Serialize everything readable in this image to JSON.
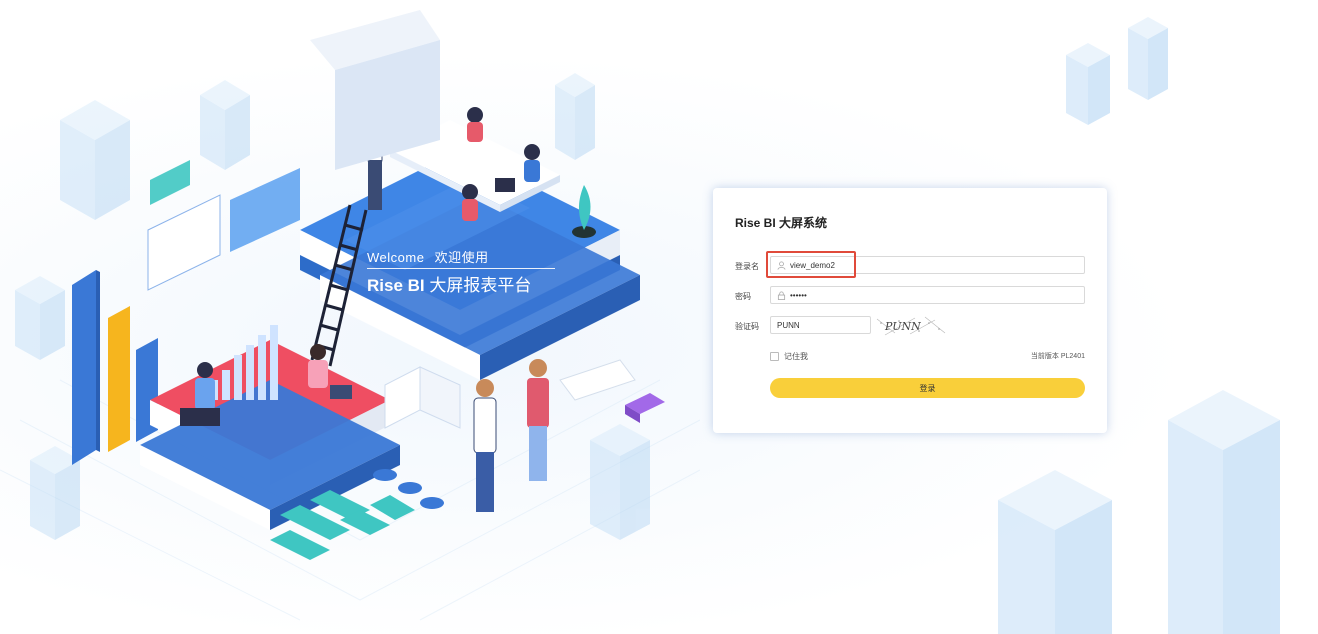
{
  "hero": {
    "welcome_en": "Welcome",
    "welcome_cn": "欢迎使用",
    "brand": "Rise BI",
    "platform_cn": "大屏报表平台"
  },
  "login": {
    "title": "Rise BI 大屏系统",
    "username": {
      "label": "登录名",
      "value": "view_demo2",
      "icon": "user-icon"
    },
    "password": {
      "label": "密码",
      "value": "••••••",
      "icon": "lock-icon"
    },
    "captcha": {
      "label": "验证码",
      "value": "PUNN",
      "image_text": "PUNN"
    },
    "remember_label": "记住我",
    "version_text": "当前版本 PL2401",
    "submit_label": "登录"
  },
  "colors": {
    "accent_yellow": "#f9cf3a",
    "highlight_red": "#e04a3a",
    "brand_blue": "#3a78d6"
  }
}
